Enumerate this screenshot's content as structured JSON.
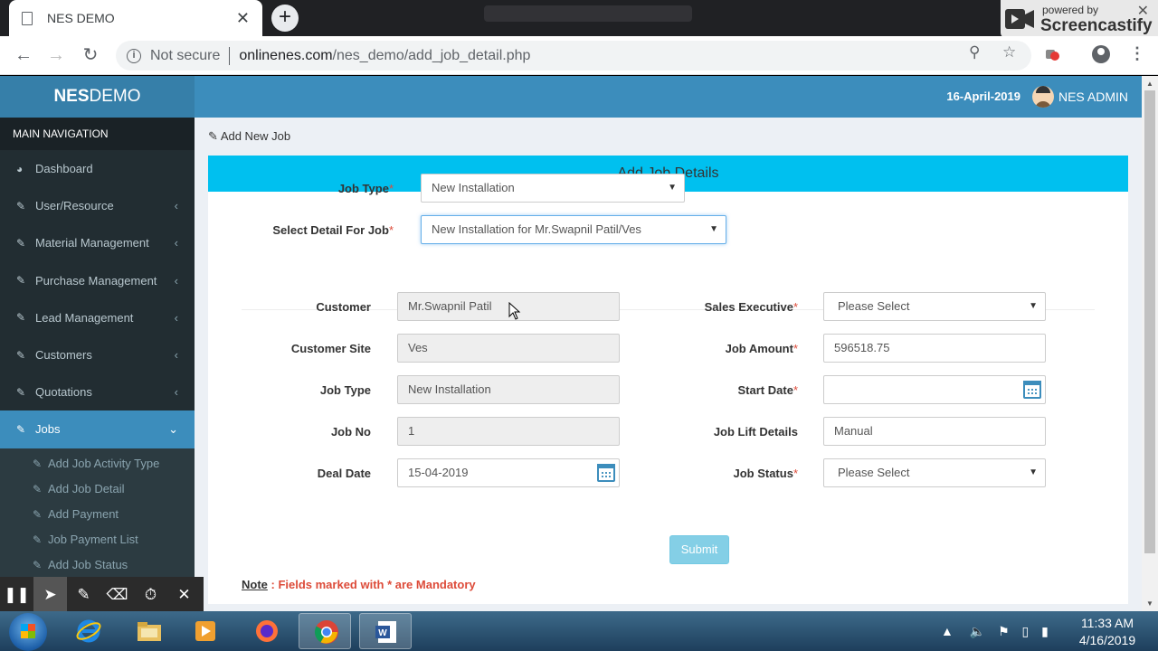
{
  "browser": {
    "tab_title": "NES DEMO",
    "new_tab": "+",
    "security": "Not secure",
    "url_host": "onlinenes.com",
    "url_path": "/nes_demo/add_job_detail.php"
  },
  "screencastify": {
    "powered_by": "powered by",
    "brand": "Screencastify"
  },
  "app": {
    "logo_bold": "NES",
    "logo_rest": "DEMO",
    "date": "16-April-2019",
    "user": "NES ADMIN"
  },
  "sidebar": {
    "header": "MAIN NAVIGATION",
    "items": [
      {
        "label": "Dashboard"
      },
      {
        "label": "User/Resource"
      },
      {
        "label": "Material Management"
      },
      {
        "label": "Purchase Management"
      },
      {
        "label": "Lead Management"
      },
      {
        "label": "Customers"
      },
      {
        "label": "Quotations"
      },
      {
        "label": "Jobs"
      }
    ],
    "sub_items": [
      {
        "label": "Add Job Activity Type"
      },
      {
        "label": "Add Job Detail"
      },
      {
        "label": "Add Payment"
      },
      {
        "label": "Job Payment List"
      },
      {
        "label": "Add Job Status"
      }
    ]
  },
  "page": {
    "breadcrumb": "Add New Job",
    "box_title": "Add Job Details"
  },
  "form": {
    "job_type_label": "Job Type",
    "job_type_value": "New Installation",
    "select_detail_label": "Select Detail For Job",
    "select_detail_value": "New Installation for Mr.Swapnil Patil/Ves",
    "customer_label": "Customer",
    "customer_value": "Mr.Swapnil Patil",
    "customer_site_label": "Customer Site",
    "customer_site_value": "Ves",
    "job_type2_label": "Job Type",
    "job_type2_value": "New Installation",
    "job_no_label": "Job No",
    "job_no_value": "1",
    "deal_date_label": "Deal Date",
    "deal_date_value": "15-04-2019",
    "sales_exec_label": "Sales Executive",
    "sales_exec_value": "Please Select",
    "job_amount_label": "Job Amount",
    "job_amount_value": "596518.75",
    "start_date_label": "Start Date",
    "start_date_value": "",
    "lift_details_label": "Job Lift Details",
    "lift_details_value": "Manual",
    "job_status_label": "Job Status",
    "job_status_value": "Please Select",
    "required_mark": "*",
    "submit": "Submit",
    "note_title": "Note",
    "note_text": " : Fields marked with * are Mandatory"
  },
  "taskbar": {
    "time": "11:33 AM",
    "date": "4/16/2019"
  },
  "colors": {
    "header_blue": "#3c8dbc",
    "logo_blue": "#367fa9",
    "sidebar_dark": "#222d32",
    "box_header": "#00c0ef",
    "required_red": "#dd4b39"
  }
}
